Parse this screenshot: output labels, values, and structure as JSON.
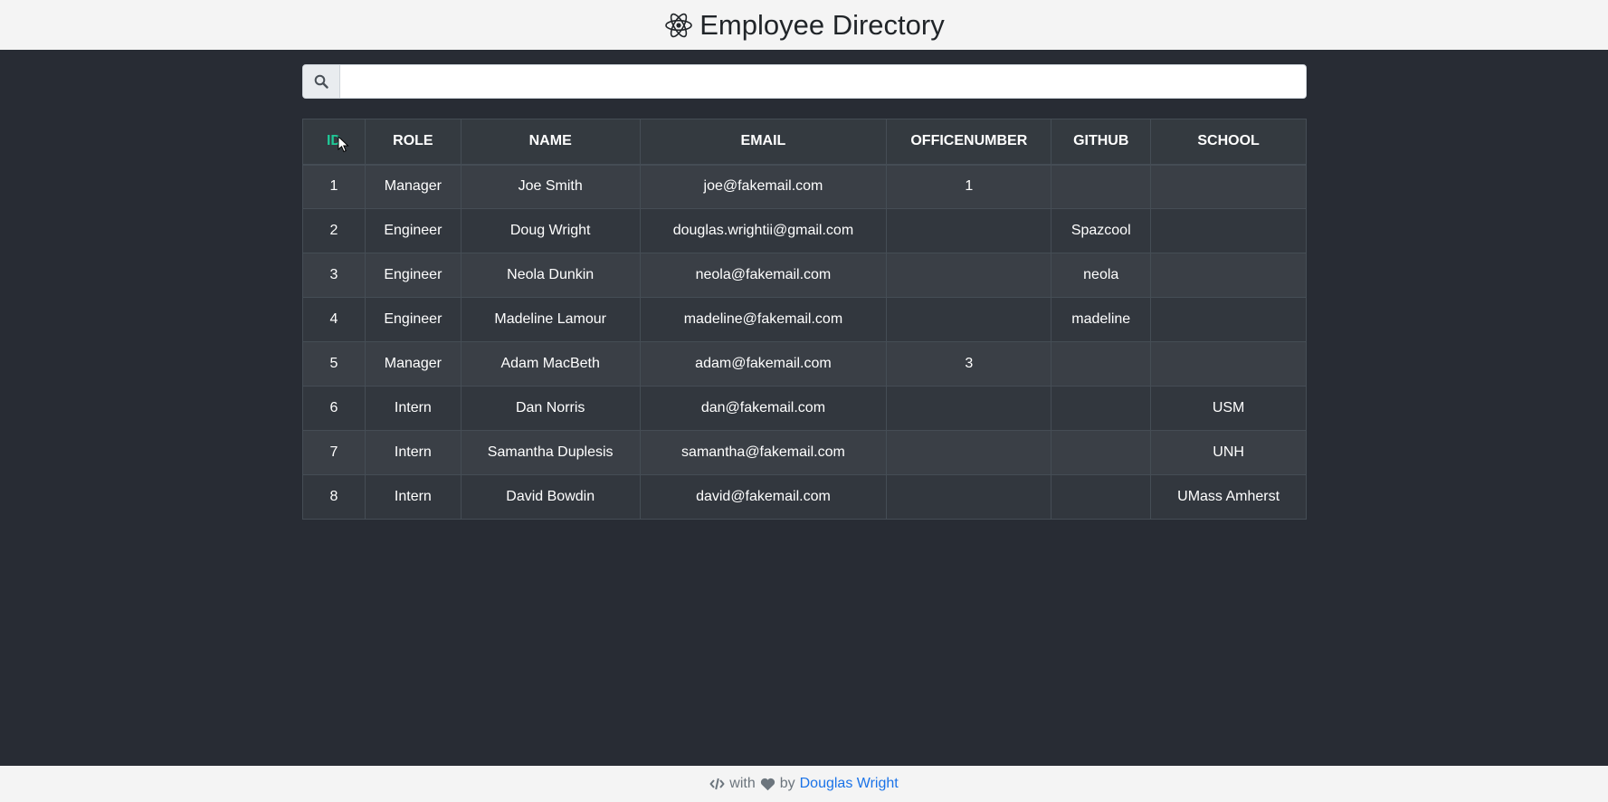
{
  "header": {
    "title": "Employee Directory",
    "logo_icon": "react-atom-icon"
  },
  "search": {
    "icon": "search-icon",
    "value": "",
    "placeholder": ""
  },
  "table": {
    "columns": [
      "ID",
      "ROLE",
      "NAME",
      "EMAIL",
      "OFFICENUMBER",
      "GITHUB",
      "SCHOOL"
    ],
    "active_sort_column": "ID",
    "rows": [
      [
        "1",
        "Manager",
        "Joe Smith",
        "joe@fakemail.com",
        "1",
        "",
        ""
      ],
      [
        "2",
        "Engineer",
        "Doug Wright",
        "douglas.wrightii@gmail.com",
        "",
        "Spazcool",
        ""
      ],
      [
        "3",
        "Engineer",
        "Neola Dunkin",
        "neola@fakemail.com",
        "",
        "neola",
        ""
      ],
      [
        "4",
        "Engineer",
        "Madeline Lamour",
        "madeline@fakemail.com",
        "",
        "madeline",
        ""
      ],
      [
        "5",
        "Manager",
        "Adam MacBeth",
        "adam@fakemail.com",
        "3",
        "",
        ""
      ],
      [
        "6",
        "Intern",
        "Dan Norris",
        "dan@fakemail.com",
        "",
        "",
        "USM"
      ],
      [
        "7",
        "Intern",
        "Samantha Duplesis",
        "samantha@fakemail.com",
        "",
        "",
        "UNH"
      ],
      [
        "8",
        "Intern",
        "David Bowdin",
        "david@fakemail.com",
        "",
        "",
        "UMass Amherst"
      ]
    ]
  },
  "footer": {
    "code_icon": "code-icon",
    "with_text": "with",
    "heart_icon": "heart-icon",
    "by_text": "by",
    "author": "Douglas Wright"
  },
  "colors": {
    "background": "#282c34",
    "header_bg": "#f4f4f4",
    "active_sort": "#20c997",
    "link": "#1a73e8"
  }
}
